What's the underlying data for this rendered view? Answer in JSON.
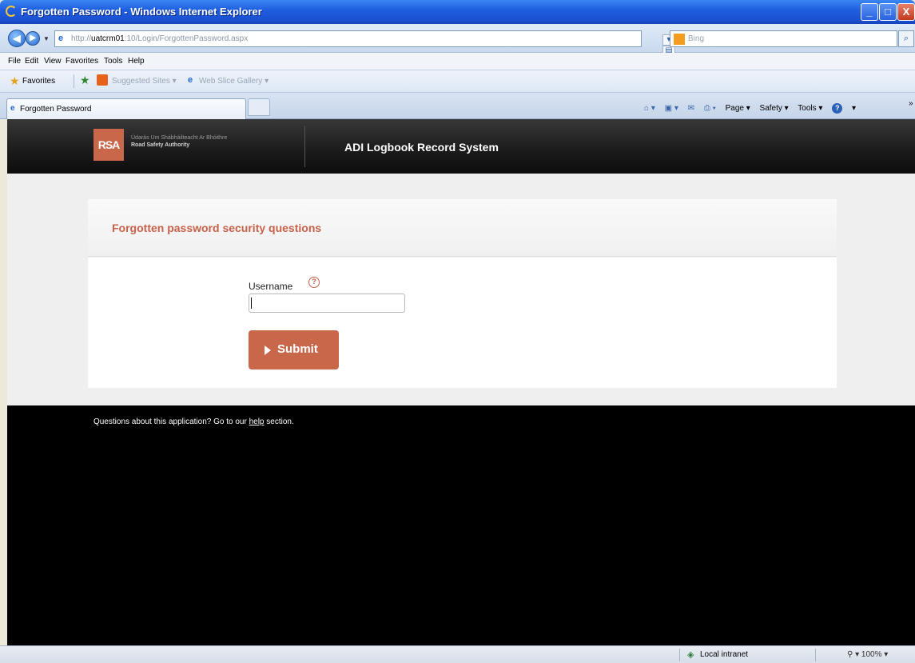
{
  "window": {
    "title": "Forgotten Password - Windows Internet Explorer",
    "min_glyph": "_",
    "max_glyph": "□",
    "close_glyph": "X"
  },
  "address": {
    "url_prefix": "http://",
    "url_host": "uatcrm01",
    "url_rest": ":10/Login/ForgottenPassword.aspx",
    "search_placeholder": "Bing"
  },
  "menu": [
    "File",
    "Edit",
    "View",
    "Favorites",
    "Tools",
    "Help"
  ],
  "favorites": {
    "label": "Favorites",
    "suggested": "Suggested Sites ▾",
    "gallery": "Web Slice Gallery ▾"
  },
  "tab": {
    "label": "Forgotten Password"
  },
  "commands": {
    "page": "Page ▾",
    "safety": "Safety ▾",
    "tools": "Tools ▾"
  },
  "site": {
    "logo_text": "RSA",
    "org_irish": "Údarás Um Shábháilteacht Ar Bhóithre",
    "org_english": "Road Safety Authority",
    "system_title": "ADI Logbook Record System"
  },
  "form": {
    "heading": "Forgotten password security questions",
    "username_label": "Username",
    "username_value": "",
    "submit_label": "Submit"
  },
  "footer": {
    "text_before": "Questions about this application? Go to our ",
    "link": "help",
    "text_after": " section."
  },
  "status": {
    "zone": "Local intranet",
    "zoom": "100%"
  },
  "colors": {
    "brand": "#c8674a",
    "title_bar": "#1f5fe0"
  }
}
